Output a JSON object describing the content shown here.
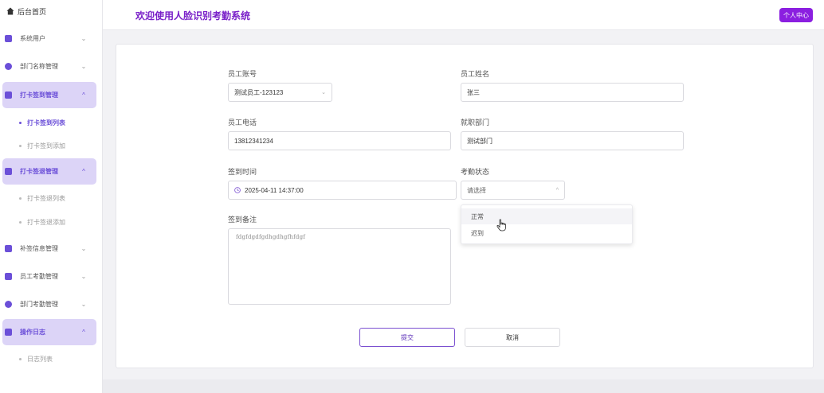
{
  "sidebar": {
    "home": "后台首页",
    "items": [
      {
        "label": "系统用户",
        "chevron": "⌄",
        "icon": "user-icon"
      },
      {
        "label": "部门名称管理",
        "chevron": "⌄",
        "icon": "department-icon"
      },
      {
        "label": "打卡签到管理",
        "chevron": "^",
        "icon": "checkin-icon"
      },
      {
        "label": "打卡签退管理",
        "chevron": "^",
        "icon": "checkout-icon"
      },
      {
        "label": "补签信息管理",
        "chevron": "⌄",
        "icon": "supplement-icon"
      },
      {
        "label": "员工考勤管理",
        "chevron": "⌄",
        "icon": "staff-attendance-icon"
      },
      {
        "label": "部门考勤管理",
        "chevron": "⌄",
        "icon": "dept-attendance-icon"
      },
      {
        "label": "操作日志",
        "chevron": "^",
        "icon": "log-icon"
      }
    ],
    "subitems": {
      "checkin_list": "打卡签到列表",
      "checkin_add": "打卡签到添加",
      "checkout_list": "打卡签退列表",
      "checkout_add": "打卡签退添加",
      "log_list": "日志列表"
    }
  },
  "header": {
    "title": "欢迎使用人脸识别考勤系统",
    "profile_button": "个人中心"
  },
  "form": {
    "account_label": "员工账号",
    "account_value": "测试员工-123123",
    "name_label": "员工姓名",
    "name_value": "张三",
    "phone_label": "员工电话",
    "phone_value": "13812341234",
    "dept_label": "就职部门",
    "dept_value": "测试部门",
    "time_label": "签到时间",
    "time_value": "2025-04-11 14:37:00",
    "status_label": "考勤状态",
    "status_placeholder": "请选择",
    "status_options": [
      "正常",
      "迟到"
    ],
    "remark_label": "签到备注",
    "remark_value": "fdgfdgdfgdhgdhgfhfdgf",
    "submit": "提交",
    "cancel": "取消"
  },
  "colors": {
    "accent": "#6b4fd8",
    "title": "#7a21c9",
    "profile_button": "#8b1fe0",
    "sidebar_active_bg": "#dcd4f7"
  }
}
